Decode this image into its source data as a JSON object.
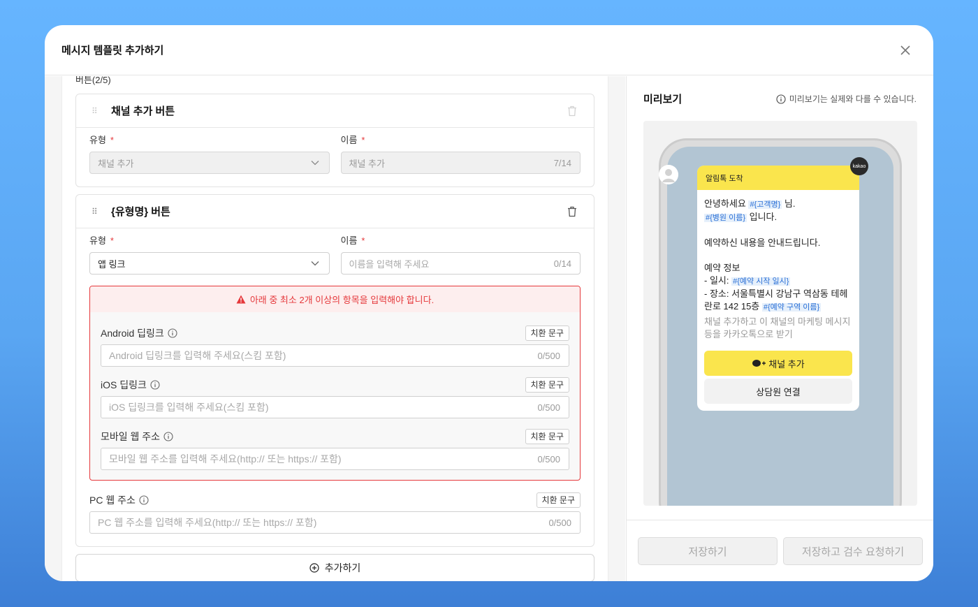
{
  "modal": {
    "title": "메시지 템플릿 추가하기"
  },
  "buttons_section": {
    "label": "버튼(2/5)",
    "card1": {
      "title": "채널 추가 버튼",
      "type_label": "유형",
      "type_value": "채널 추가",
      "name_label": "이름",
      "name_value": "채널 추가",
      "name_counter": "7/14"
    },
    "card2": {
      "title": "{유형명} 버튼",
      "type_label": "유형",
      "type_value": "앱 링크",
      "name_label": "이름",
      "name_placeholder": "이름을 입력해 주세요",
      "name_counter": "0/14",
      "warning": "아래 중 최소 2개 이상의 항목을 입력해야 합니다.",
      "android": {
        "label": "Android 딥링크",
        "replace": "치환 문구",
        "placeholder": "Android 딥링크를 입력해 주세요(스킴 포함)",
        "counter": "0/500"
      },
      "ios": {
        "label": "iOS 딥링크",
        "replace": "치환 문구",
        "placeholder": "iOS 딥링크를 입력해 주세요(스킴 포함)",
        "counter": "0/500"
      },
      "mobile_web": {
        "label": "모바일 웹 주소",
        "replace": "치환 문구",
        "placeholder": "모바일 웹 주소를 입력해 주세요(http:// 또는 https:// 포함)",
        "counter": "0/500"
      },
      "pc_web": {
        "label": "PC 웹 주소",
        "replace": "치환 문구",
        "placeholder": "PC 웹 주소를 입력해 주세요(http:// 또는 https:// 포함)",
        "counter": "0/500"
      }
    },
    "add_button": "추가하기"
  },
  "preview": {
    "title": "미리보기",
    "note": "미리보기는 실제와 다를 수 있습니다.",
    "bubble_header": "알림톡 도착",
    "kakao_badge": "kakao",
    "greeting": "안녕하세요",
    "var_customer": "#{고객명}",
    "suffix_nim": "님.",
    "var_hospital": "#{병원 이름}",
    "suffix_ipnida": "입니다.",
    "line_guide": "예약하신 내용을 안내드립니다.",
    "line_info": "예약 정보",
    "line_date_prefix": "- 일시:",
    "var_datetime": "#{예약 시작 일시}",
    "line_place": "- 장소: 서울특별시 강남구 역삼동 테헤란로 142 15층",
    "var_zone": "#{예약 구역 이름}",
    "sub_text": "채널 추가하고 이 채널의 마케팅 메시지 등을 카카오톡으로 받기",
    "channel_button": "채널 추가",
    "counsel_button": "상담원 연결"
  },
  "footer": {
    "save": "저장하기",
    "save_review": "저장하고 검수 요청하기"
  },
  "colors": {
    "accent_red": "#e5383b",
    "kakao_yellow": "#fae54d",
    "variable_blue": "#2a6fd6"
  }
}
